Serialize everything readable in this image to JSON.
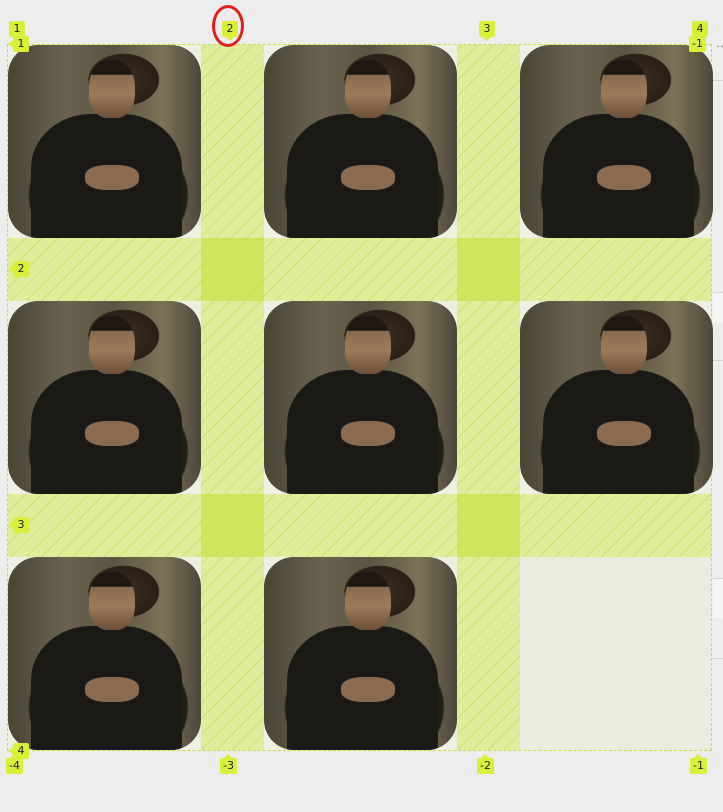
{
  "grid_overlay": {
    "accent_color": "#d9ef3a",
    "column_line_numbers_top": [
      "1",
      "2",
      "3",
      "4"
    ],
    "column_line_numbers_bottom": [
      "-4",
      "-3",
      "-2",
      "-1"
    ],
    "row_line_numbers_left": [
      "1",
      "2",
      "3",
      "4"
    ],
    "row_line_number_right_top": "-1",
    "highlighted_line_number": "2",
    "highlight_color": "#e0201c"
  },
  "cells": [
    {
      "content": "photo"
    },
    {
      "content": "photo"
    },
    {
      "content": "photo"
    },
    {
      "content": "photo"
    },
    {
      "content": "photo"
    },
    {
      "content": "photo"
    },
    {
      "content": "photo"
    },
    {
      "content": "photo"
    },
    {
      "content": "empty"
    }
  ]
}
